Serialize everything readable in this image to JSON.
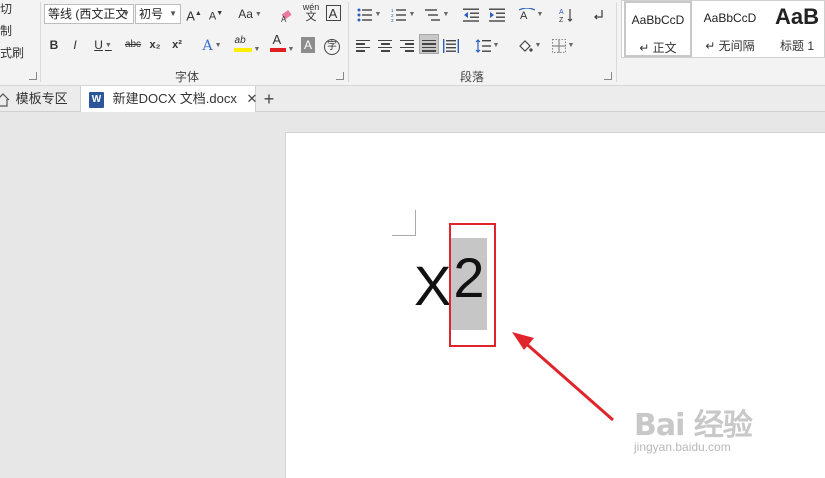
{
  "clipboard": {
    "items": [
      "剪切",
      "复制",
      "格式刷"
    ]
  },
  "font": {
    "family_value": "等线 (西文正文",
    "size_value": "初号",
    "grow_label": "A",
    "shrink_label": "A",
    "change_case_label": "Aa",
    "pinyin_label": "wén",
    "border_char_label": "A",
    "bold_label": "B",
    "italic_label": "I",
    "underline_label": "U",
    "strike_label": "abc",
    "subscript_label": "x₂",
    "superscript_label": "x²",
    "effects_label": "A",
    "highlight_label": "ab",
    "color_label": "A",
    "shading_label": "A",
    "enclose_label": "字",
    "group_label": "字体"
  },
  "paragraph": {
    "group_label": "段落",
    "sort_label": "A↓Z"
  },
  "styles": {
    "items": [
      {
        "sample": "AaBbCcD",
        "name": "↵ 正文"
      },
      {
        "sample": "AaBbCcD",
        "name": "↵ 无间隔"
      },
      {
        "sample": "AaB",
        "name": "标题 1"
      }
    ]
  },
  "tabs": {
    "templates_label": "模板专区",
    "doc_label": "新建DOCX 文档.docx",
    "close_label": "✕",
    "add_label": "+"
  },
  "document": {
    "base_text": "X",
    "selected_text": "2"
  },
  "watermark": {
    "main": "Bai 经验",
    "sub": "jingyan.baidu.com"
  },
  "colors": {
    "highlight_box": "#e0242c",
    "arrow": "#e0242c",
    "selection": "#c6c6c6",
    "font_color_bar": "#e02020",
    "highlight_bar": "#ffee00"
  }
}
